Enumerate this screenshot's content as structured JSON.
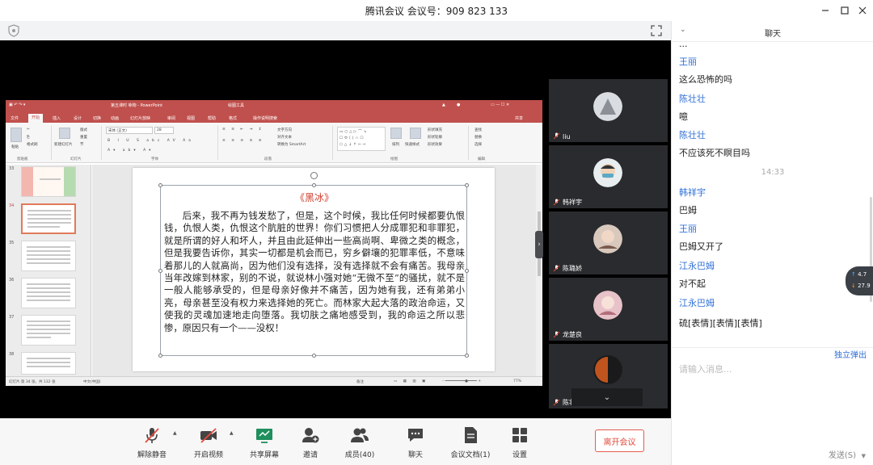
{
  "window": {
    "title": "腾讯会议 会议号：909 823 133",
    "min_icon": "minimize-icon",
    "max_icon": "maximize-icon",
    "close_icon": "close-icon"
  },
  "share": {
    "ppt_title": "第五课时 咏物 - PowerPoint",
    "ppt_context": "绘图工具",
    "ppt_share": "共享",
    "tabs": [
      "文件",
      "开始",
      "插入",
      "设计",
      "切换",
      "动画",
      "幻灯片放映",
      "审阅",
      "视图",
      "帮助",
      "格式",
      "操作说明搜索"
    ],
    "ribbon": {
      "font_name": "宋体 (正文)",
      "font_size": "28",
      "paste": "粘贴",
      "new_slide": "新建幻灯片",
      "layout": "版式",
      "reset": "重置",
      "section": "节",
      "format_painter": "格式刷",
      "text_direction": "文字方向",
      "align_text": "对齐文本",
      "smartart": "转换为 SmartArt",
      "arrange": "排列",
      "quick_styles": "快速样式",
      "fill": "形状填充",
      "outline": "形状轮廓",
      "effects": "形状效果",
      "find": "查找",
      "replace": "替换",
      "select": "选择",
      "groups": [
        "剪贴板",
        "幻灯片",
        "字体",
        "段落",
        "绘图",
        "编辑"
      ]
    },
    "thumb_numbers": [
      "33",
      "34",
      "35",
      "36",
      "37",
      "38"
    ],
    "slide_title": "《黑冰》",
    "slide_body": "后来，我不再为钱发愁了，但是，这个时候，我比任何时候都要仇恨钱，仇恨人类，仇恨这个肮脏的世界！你们习惯把人分成罪犯和非罪犯，就是所谓的好人和坏人，并且由此延伸出一些高尚啊、卑微之类的概念，但是我要告诉你，其实一切都是机会而已，穷乡僻壤的犯罪率低，不意味着那儿的人就高尚，因为他们没有选择，没有选择就不会有痛苦。我母亲当年改嫁到林家，别的不说，就说林小强对她“无微不至”的骚扰，就不是一般人能够承受的，但是母亲好像并不痛苦，因为她有我，还有弟弟小亮，母亲甚至没有权力来选择她的死亡。而林家大起大落的政治命运，又使我的灵魂加速地走向堕落。我切肤之痛地感受到，我的命运之所以悲惨，原因只有一个——没权！",
    "status_left": "幻灯片 第 34 张，共 132 张",
    "status_lang": "中文(中国)",
    "status_notes": "备注",
    "status_zoom": "77%"
  },
  "participants": [
    {
      "name": "liu",
      "avatar_color": "#cfd3d8"
    },
    {
      "name": "韩祥宇",
      "avatar_color": "#dfe6ea"
    },
    {
      "name": "陈璐娇",
      "avatar_color": "#d9c9bd"
    },
    {
      "name": "龙楚良",
      "avatar_color": "#e7c2c8"
    },
    {
      "name": "陈壮壮",
      "avatar_color": "#c0541e"
    }
  ],
  "toolbar": {
    "mute": "解除静音",
    "video": "开启视频",
    "share": "共享屏幕",
    "invite": "邀请",
    "members": "成员(40)",
    "chat": "聊天",
    "docs": "会议文档(1)",
    "settings": "设置",
    "leave": "离开会议"
  },
  "chat": {
    "title": "聊天",
    "first_line": "...",
    "messages": [
      {
        "name": "王丽",
        "text": "这么恐怖的吗"
      },
      {
        "name": "陈壮壮",
        "text": "噫"
      },
      {
        "name": "陈壮壮",
        "text": "不应该死不瞑目吗"
      },
      {
        "name": "韩祥宇",
        "text": "巴姆"
      },
      {
        "name": "王丽",
        "text": "巴姆又开了"
      },
      {
        "name": "江永巴姆",
        "text": "对不起"
      },
      {
        "name": "江永巴姆",
        "text": "硫[表情][表情][表情]"
      }
    ],
    "time": "14:33",
    "popout": "独立弹出",
    "placeholder": "请输入消息...",
    "send": "发送(S)"
  },
  "network": {
    "up": "4.7",
    "down": "27.9"
  },
  "colors": {
    "accent": "#2f6fd6",
    "leave": "#e14b3b",
    "ppt": "#c0504d",
    "slide_title": "#d13c2a"
  }
}
